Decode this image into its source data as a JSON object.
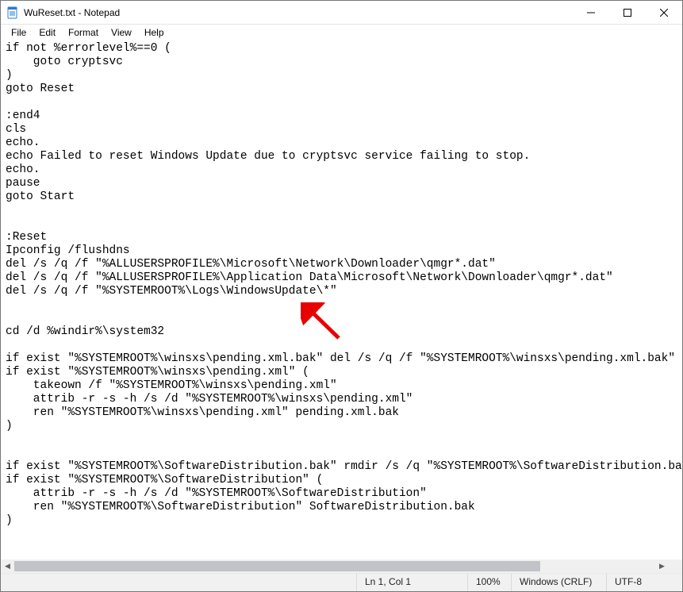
{
  "window": {
    "title": "WuReset.txt - Notepad"
  },
  "menubar": {
    "items": [
      "File",
      "Edit",
      "Format",
      "View",
      "Help"
    ]
  },
  "editor": {
    "content": "if not %errorlevel%==0 (\n    goto cryptsvc\n)\ngoto Reset\n\n:end4\ncls\necho.\necho Failed to reset Windows Update due to cryptsvc service failing to stop.\necho.\npause\ngoto Start\n\n\n:Reset\nIpconfig /flushdns\ndel /s /q /f \"%ALLUSERSPROFILE%\\Microsoft\\Network\\Downloader\\qmgr*.dat\"\ndel /s /q /f \"%ALLUSERSPROFILE%\\Application Data\\Microsoft\\Network\\Downloader\\qmgr*.dat\"\ndel /s /q /f \"%SYSTEMROOT%\\Logs\\WindowsUpdate\\*\"\n\n\ncd /d %windir%\\system32\n\nif exist \"%SYSTEMROOT%\\winsxs\\pending.xml.bak\" del /s /q /f \"%SYSTEMROOT%\\winsxs\\pending.xml.bak\"\nif exist \"%SYSTEMROOT%\\winsxs\\pending.xml\" (\n    takeown /f \"%SYSTEMROOT%\\winsxs\\pending.xml\"\n    attrib -r -s -h /s /d \"%SYSTEMROOT%\\winsxs\\pending.xml\"\n    ren \"%SYSTEMROOT%\\winsxs\\pending.xml\" pending.xml.bak\n)\n\n\nif exist \"%SYSTEMROOT%\\SoftwareDistribution.bak\" rmdir /s /q \"%SYSTEMROOT%\\SoftwareDistribution.bak\"\nif exist \"%SYSTEMROOT%\\SoftwareDistribution\" (\n    attrib -r -s -h /s /d \"%SYSTEMROOT%\\SoftwareDistribution\"\n    ren \"%SYSTEMROOT%\\SoftwareDistribution\" SoftwareDistribution.bak\n)\n"
  },
  "statusbar": {
    "position": "Ln 1, Col 1",
    "zoom": "100%",
    "eol": "Windows (CRLF)",
    "encoding": "UTF-8"
  }
}
